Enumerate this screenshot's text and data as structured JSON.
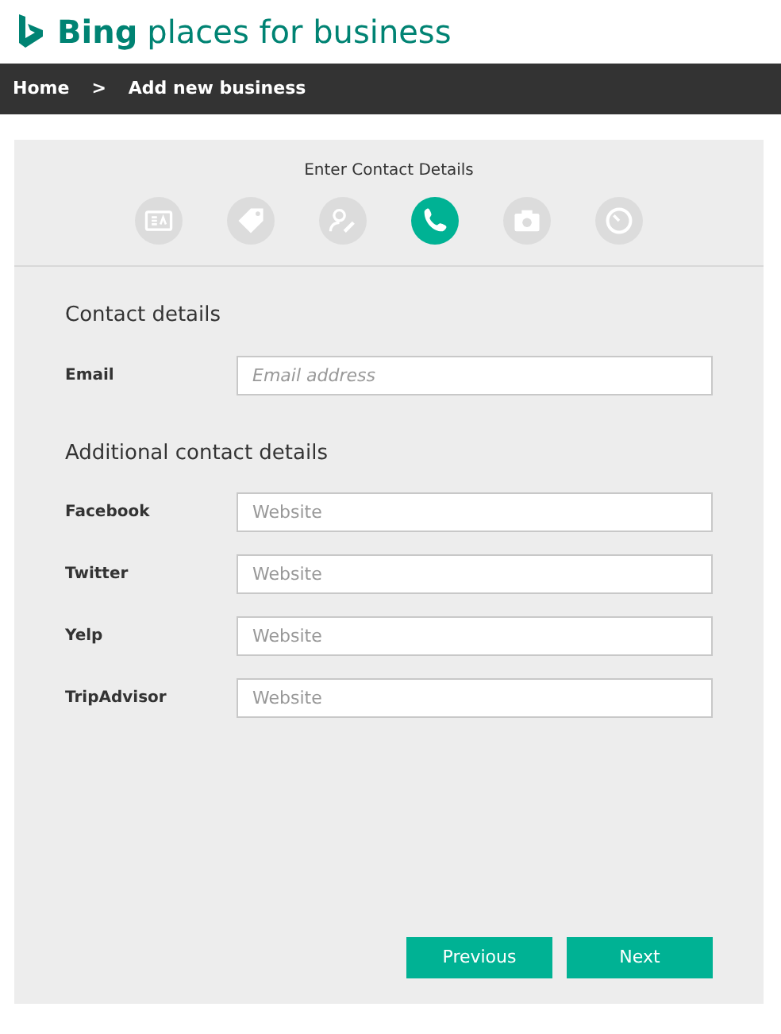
{
  "header": {
    "brand": "Bing",
    "product": "places for business"
  },
  "breadcrumb": [
    {
      "label": "Home"
    },
    {
      "label": ">"
    },
    {
      "label": "Add new business"
    }
  ],
  "wizard": {
    "title": "Enter Contact Details",
    "steps": [
      {
        "kind": "card",
        "selected": false
      },
      {
        "kind": "tag",
        "selected": false
      },
      {
        "kind": "person",
        "selected": false
      },
      {
        "kind": "phone",
        "selected": true
      },
      {
        "kind": "camera",
        "selected": false
      },
      {
        "kind": "clock",
        "selected": false
      }
    ]
  },
  "sections": [
    {
      "heading": "Contact details",
      "fields": [
        {
          "label": "Email",
          "kind": "email",
          "placeholder": "Email address"
        }
      ]
    },
    {
      "heading": "Additional contact details",
      "fields": [
        {
          "label": "Facebook",
          "kind": "website",
          "placeholder": "Website"
        },
        {
          "label": "Twitter",
          "kind": "website",
          "placeholder": "Website"
        },
        {
          "label": "Yelp",
          "kind": "website",
          "placeholder": "Website"
        },
        {
          "label": "TripAdvisor",
          "kind": "website",
          "placeholder": "Website"
        }
      ]
    }
  ],
  "buttons": [
    {
      "label": "Previous"
    },
    {
      "label": "Next"
    }
  ]
}
